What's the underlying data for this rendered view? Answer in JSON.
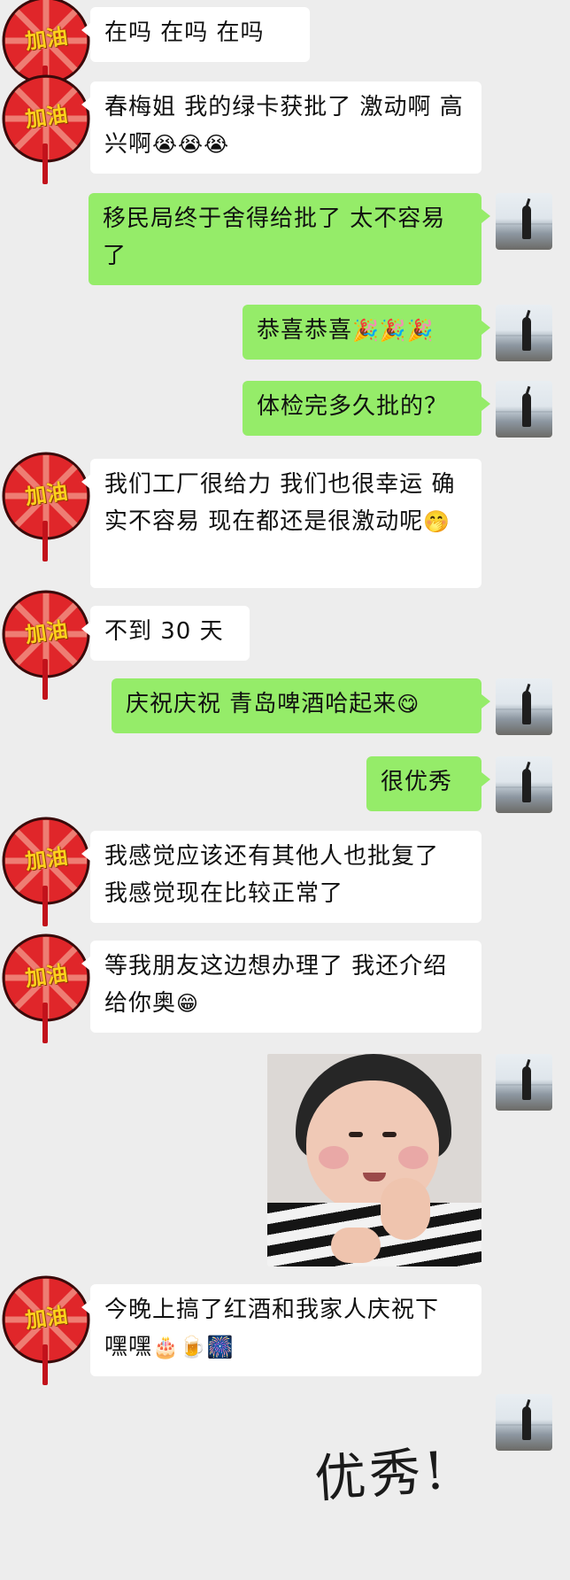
{
  "messages": [
    {
      "side": "in",
      "text": "在吗  在吗 在吗",
      "emoji": ""
    },
    {
      "side": "in",
      "text": "春梅姐 我的绿卡获批了  激动啊 高兴啊",
      "emoji": "😭😭😭"
    },
    {
      "side": "out",
      "text": "移民局终于舍得给批了  太不容易了",
      "emoji": ""
    },
    {
      "side": "out",
      "text": "恭喜恭喜",
      "emoji": "🎉🎉🎉"
    },
    {
      "side": "out",
      "text": "体检完多久批的？",
      "emoji": ""
    },
    {
      "side": "in",
      "text": "我们工厂很给力  我们也很幸运  确实不容易  现在都还是很激动呢",
      "emoji": "🤭"
    },
    {
      "side": "in",
      "text": "不到 30 天",
      "emoji": ""
    },
    {
      "side": "out",
      "text": "庆祝庆祝 青岛啤酒哈起来",
      "emoji": "😋"
    },
    {
      "side": "out",
      "text": "很优秀",
      "emoji": ""
    },
    {
      "side": "in",
      "text": "我感觉应该还有其他人也批复了  我感觉现在比较正常了",
      "emoji": ""
    },
    {
      "side": "in",
      "text": "等我朋友这边想办理了 我还介绍给你奥",
      "emoji": "😁"
    },
    {
      "side": "in",
      "text": "今晚上搞了红酒和我家人庆祝下 嘿嘿",
      "emoji": "🎂🍺🎆"
    }
  ],
  "avatar_badge_text": "加油",
  "handwriting_text": "优秀!",
  "colors": {
    "background": "#ededed",
    "incoming": "#ffffff",
    "outgoing": "#95ec69",
    "avatar_red": "#e0262a"
  },
  "icons": {
    "incoming_avatar": "lollipop-avatar",
    "outgoing_avatar": "beach-silhouette-avatar",
    "sticker": "child-photo-sticker"
  }
}
